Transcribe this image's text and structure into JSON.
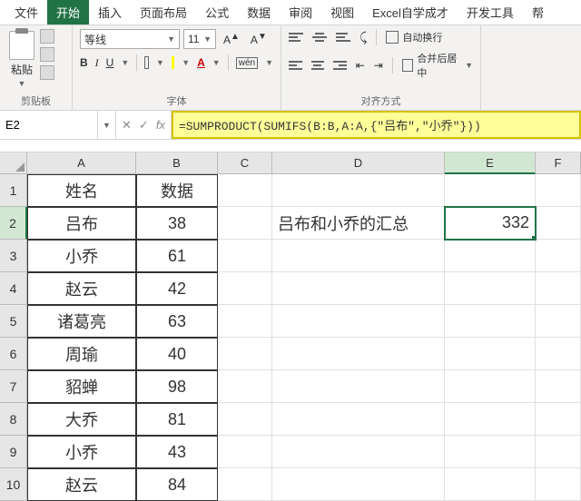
{
  "menu": {
    "items": [
      "文件",
      "开始",
      "插入",
      "页面布局",
      "公式",
      "数据",
      "审阅",
      "视图",
      "Excel自学成才",
      "开发工具",
      "帮"
    ],
    "active_index": 1
  },
  "ribbon": {
    "clipboard": {
      "paste": "粘贴",
      "label": "剪贴板"
    },
    "font": {
      "name": "等线",
      "size": "11",
      "grow": "A^",
      "shrink": "A˅",
      "bold": "B",
      "italic": "I",
      "underline": "U",
      "wen": "wén",
      "label": "字体"
    },
    "align": {
      "wrap": "自动换行",
      "merge": "合并后居中",
      "label": "对齐方式"
    }
  },
  "formula_bar": {
    "cell_ref": "E2",
    "cancel": "✕",
    "confirm": "✓",
    "fx": "fx",
    "formula": "=SUMPRODUCT(SUMIFS(B:B,A:A,{\"吕布\",\"小乔\"}))"
  },
  "columns": [
    "A",
    "B",
    "C",
    "D",
    "E",
    "F"
  ],
  "row_numbers": [
    "1",
    "2",
    "3",
    "4",
    "5",
    "6",
    "7",
    "8",
    "9",
    "10"
  ],
  "table": {
    "headers": {
      "name": "姓名",
      "data": "数据"
    },
    "rows": [
      {
        "name": "吕布",
        "data": "38"
      },
      {
        "name": "小乔",
        "data": "61"
      },
      {
        "name": "赵云",
        "data": "42"
      },
      {
        "name": "诸葛亮",
        "data": "63"
      },
      {
        "name": "周瑜",
        "data": "40"
      },
      {
        "name": "貂蝉",
        "data": "98"
      },
      {
        "name": "大乔",
        "data": "81"
      },
      {
        "name": "小乔",
        "data": "43"
      },
      {
        "name": "赵云",
        "data": "84"
      }
    ]
  },
  "summary": {
    "label": "吕布和小乔的汇总",
    "value": "332"
  }
}
